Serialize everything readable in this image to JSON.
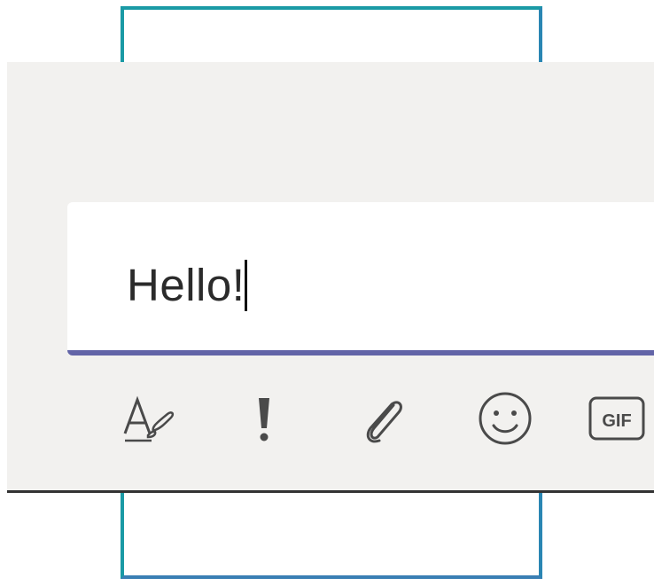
{
  "compose": {
    "message_text": "Hello!"
  },
  "toolbar": {
    "buttons": [
      {
        "icon": "format-icon",
        "label": ""
      },
      {
        "icon": "important-icon",
        "label": ""
      },
      {
        "icon": "attach-icon",
        "label": ""
      },
      {
        "icon": "emoji-icon",
        "label": ""
      },
      {
        "icon": "gif-icon",
        "label": "GIF"
      }
    ]
  },
  "colors": {
    "panel_bg": "#f2f1ef",
    "accent_underline": "#6264a7",
    "frame": "#1a9aa5",
    "icon": "#4a4a4a"
  }
}
